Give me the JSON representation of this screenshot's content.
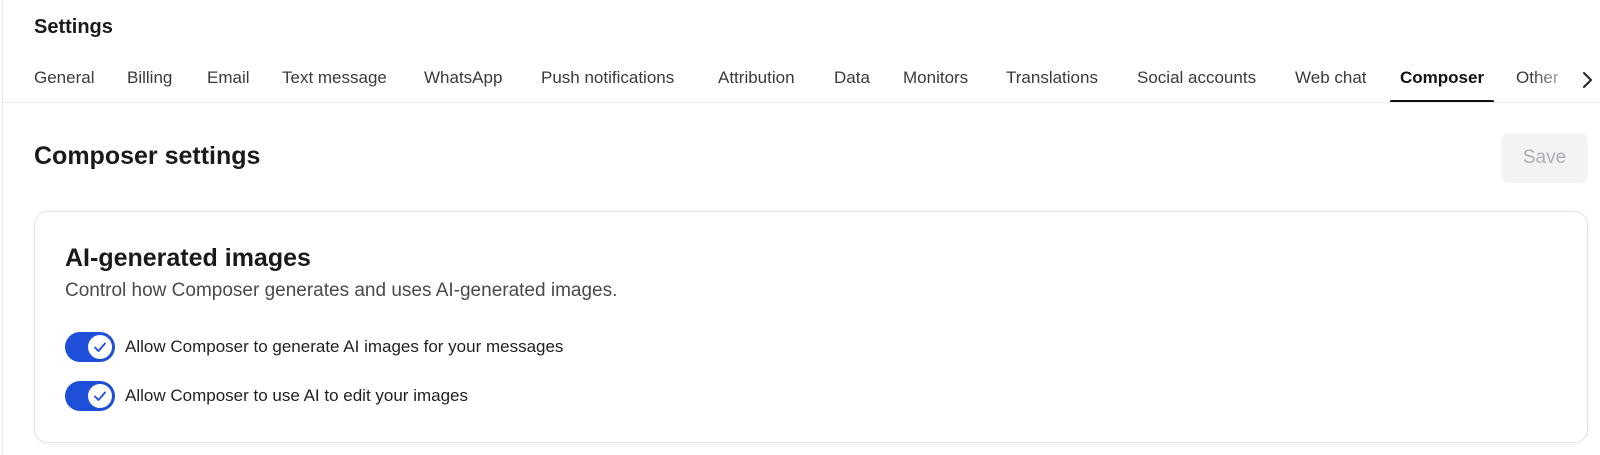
{
  "header": {
    "title": "Settings"
  },
  "tabs": [
    {
      "label": "General"
    },
    {
      "label": "Billing"
    },
    {
      "label": "Email"
    },
    {
      "label": "Text message"
    },
    {
      "label": "WhatsApp"
    },
    {
      "label": "Push notifications"
    },
    {
      "label": "Attribution"
    },
    {
      "label": "Data"
    },
    {
      "label": "Monitors"
    },
    {
      "label": "Translations"
    },
    {
      "label": "Social accounts"
    },
    {
      "label": "Web chat"
    },
    {
      "label": "Composer",
      "active": true
    },
    {
      "label": "Other"
    }
  ],
  "tab_scroll_icon": "chevron-right-icon",
  "section": {
    "title": "Composer settings",
    "save_label": "Save",
    "save_enabled": false
  },
  "card": {
    "title": "AI-generated images",
    "description": "Control how Composer generates and uses AI-generated images.",
    "toggles": [
      {
        "label": "Allow Composer to generate AI images for your messages",
        "on": true
      },
      {
        "label": "Allow Composer to use AI to edit your images",
        "on": true
      }
    ]
  },
  "colors": {
    "accent": "#1f4fd8",
    "save_bg": "#f2f3f5",
    "save_text": "#a9adb4",
    "active_tab": "#111111"
  }
}
